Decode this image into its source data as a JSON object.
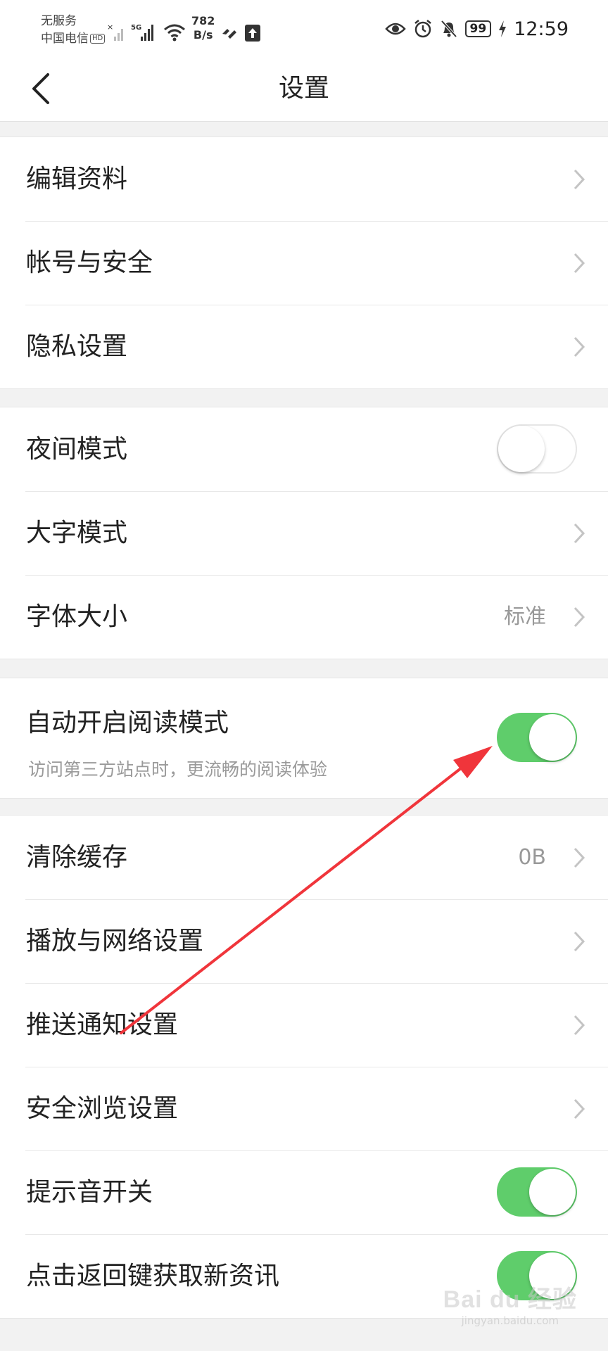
{
  "status_bar": {
    "carrier_line1": "无服务",
    "carrier_line2": "中国电信",
    "hd_badge": "HD",
    "network_5g": "5G",
    "speed_value": "782",
    "speed_unit": "B/s",
    "battery": "99",
    "time": "12:59"
  },
  "nav": {
    "title": "设置",
    "back_icon": "chevron-left-icon"
  },
  "groups": [
    {
      "rows": [
        {
          "label": "编辑资料",
          "type": "link"
        },
        {
          "label": "帐号与安全",
          "type": "link"
        },
        {
          "label": "隐私设置",
          "type": "link"
        }
      ]
    },
    {
      "rows": [
        {
          "label": "夜间模式",
          "type": "toggle",
          "on": false
        },
        {
          "label": "大字模式",
          "type": "link"
        },
        {
          "label": "字体大小",
          "type": "link",
          "value": "标准"
        }
      ]
    },
    {
      "rows": [
        {
          "label": "自动开启阅读模式",
          "subtitle": "访问第三方站点时，更流畅的阅读体验",
          "type": "toggle",
          "on": true
        }
      ]
    },
    {
      "rows": [
        {
          "label": "清除缓存",
          "type": "link",
          "value": "0B"
        },
        {
          "label": "播放与网络设置",
          "type": "link"
        },
        {
          "label": "推送通知设置",
          "type": "link"
        },
        {
          "label": "安全浏览设置",
          "type": "link"
        },
        {
          "label": "提示音开关",
          "type": "toggle",
          "on": true
        },
        {
          "label": "点击返回键获取新资讯",
          "type": "toggle",
          "on": true
        }
      ]
    }
  ],
  "watermark": {
    "logo": "Bai du 经验",
    "sub": "jingyan.baidu.com"
  },
  "colors": {
    "toggle_on": "#5fcd6b",
    "annotation_arrow": "#f0353b"
  }
}
